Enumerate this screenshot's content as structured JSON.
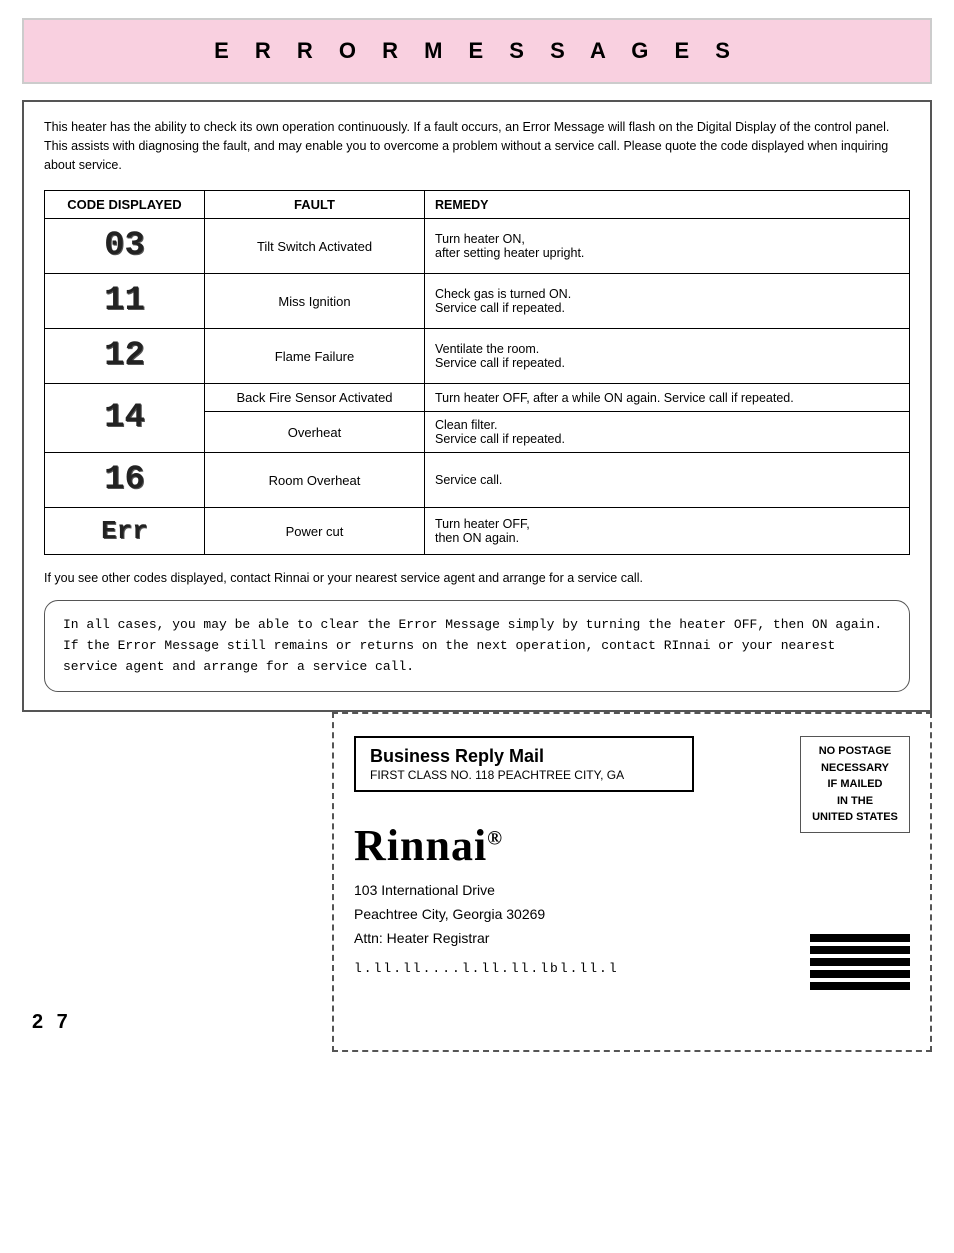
{
  "header": {
    "title": "E R R O R   M E S S A G E S"
  },
  "intro": {
    "text": "This heater has the ability to check its own operation continuously.  If a fault occurs, an Error Message will flash on the Digital Display of the control panel.  This assists with diagnosing the fault, and may enable you to overcome a problem without a service call.  Please quote the code displayed when inquiring about service."
  },
  "table": {
    "headers": {
      "code": "CODE DISPLAYED",
      "fault": "FAULT",
      "remedy": "REMEDY"
    },
    "rows": [
      {
        "code_display": "03",
        "fault": "Tilt Switch Activated",
        "remedy": "Turn heater ON,\nafter setting heater upright."
      },
      {
        "code_display": "11",
        "fault": "Miss Ignition",
        "remedy": "Check gas is turned ON.\nService call if repeated."
      },
      {
        "code_display": "12",
        "fault": "Flame Failure",
        "remedy": "Ventilate the room.\nService call if repeated."
      },
      {
        "code_display": "14",
        "fault": "Back Fire Sensor Activated",
        "remedy": "Turn heater OFF, after a while ON again. Service call if repeated."
      },
      {
        "code_display": "14",
        "fault": "Overheat",
        "remedy": "Clean filter.\nService call if repeated."
      },
      {
        "code_display": "16",
        "fault": "Room Overheat",
        "remedy": "Service call."
      },
      {
        "code_display": "Err",
        "fault": "Power cut",
        "remedy": "Turn heater OFF,\nthen ON again."
      }
    ]
  },
  "note": "If you see other codes displayed, contact Rinnai or your nearest service agent and arrange for a service call.",
  "info_box": "In all cases, you may be able to clear the Error Message simply by turning the heater OFF, then ON again.  If the Error Message still remains or returns on the next operation, contact RInnai or your nearest service agent and arrange for a service call.",
  "page_number": "2 7",
  "reply_mail": {
    "title": "Business Reply Mail",
    "subtitle": "FIRST CLASS NO. 118 PEACHTREE CITY, GA"
  },
  "postage": {
    "lines": [
      "NO POSTAGE",
      "NECESSARY",
      "IF MAILED",
      "IN THE",
      "UNITED STATES"
    ]
  },
  "rinnai": {
    "name": "Rinnai",
    "reg": "®",
    "address_line1": "103 International Drive",
    "address_line2": "Peachtree City, Georgia 30269",
    "address_line3": "Attn:  Heater Registrar"
  },
  "barcode": "l.ll.ll....l.ll.ll.lbl.ll.l"
}
